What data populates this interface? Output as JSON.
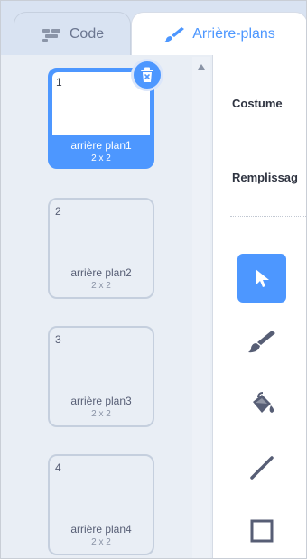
{
  "tabs": {
    "code_label": "Code",
    "backdrops_label": "Arrière-plans"
  },
  "backdrops": [
    {
      "number": "1",
      "name": "arrière plan1",
      "size": "2 x 2",
      "selected": true
    },
    {
      "number": "2",
      "name": "arrière plan2",
      "size": "2 x 2",
      "selected": false
    },
    {
      "number": "3",
      "name": "arrière plan3",
      "size": "2 x 2",
      "selected": false
    },
    {
      "number": "4",
      "name": "arrière plan4",
      "size": "2 x 2",
      "selected": false
    }
  ],
  "editor": {
    "costume_label": "Costume",
    "fill_label": "Remplissag"
  },
  "tools": [
    {
      "icon": "select-arrow-icon",
      "active": true
    },
    {
      "icon": "brush-icon",
      "active": false
    },
    {
      "icon": "fill-bucket-icon",
      "active": false
    },
    {
      "icon": "line-icon",
      "active": false
    },
    {
      "icon": "rectangle-icon",
      "active": false
    }
  ],
  "colors": {
    "accent": "#4d97ff",
    "tab_bar": "#d9e3f2",
    "list_bg": "#e9eef5",
    "text": "#575e75"
  }
}
